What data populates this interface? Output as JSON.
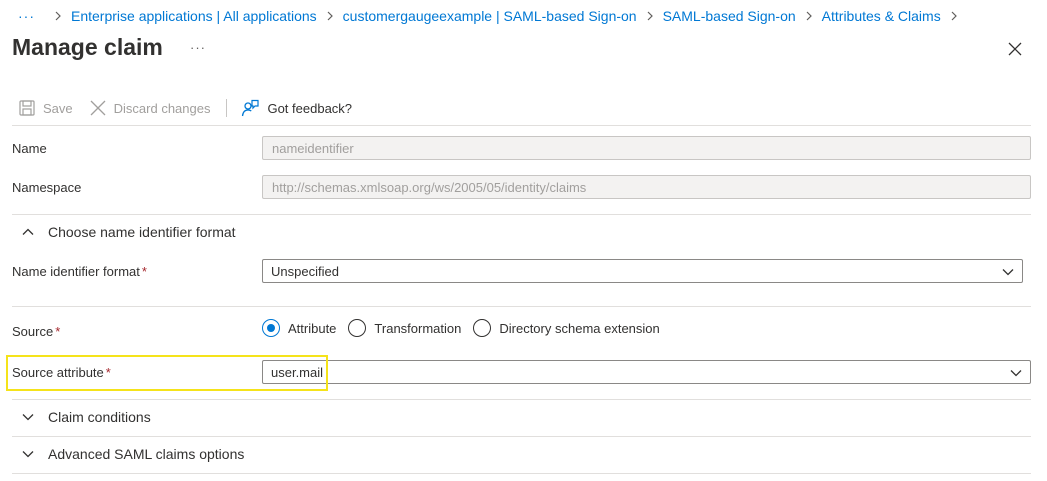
{
  "breadcrumb": {
    "more": "···",
    "items": [
      "Enterprise applications | All applications",
      "customergaugeexample | SAML-based Sign-on",
      "SAML-based Sign-on",
      "Attributes & Claims"
    ]
  },
  "header": {
    "title": "Manage claim",
    "more": "···"
  },
  "toolbar": {
    "save_label": "Save",
    "discard_label": "Discard changes",
    "feedback_label": "Got feedback?"
  },
  "form": {
    "name": {
      "label": "Name",
      "value": "nameidentifier"
    },
    "namespace": {
      "label": "Namespace",
      "value": "http://schemas.xmlsoap.org/ws/2005/05/identity/claims"
    },
    "name_id_section": {
      "label": "Choose name identifier format",
      "expanded": true
    },
    "name_id_format": {
      "label": "Name identifier format",
      "required": "*",
      "value": "Unspecified"
    },
    "source": {
      "label": "Source",
      "required": "*",
      "options": [
        "Attribute",
        "Transformation",
        "Directory schema extension"
      ],
      "selected": "Attribute"
    },
    "source_attribute": {
      "label": "Source attribute",
      "required": "*",
      "value": "user.mail"
    },
    "claim_conditions": {
      "label": "Claim conditions",
      "expanded": false
    },
    "advanced_saml": {
      "label": "Advanced SAML claims options",
      "expanded": false
    }
  },
  "colors": {
    "link": "#0078d4",
    "required": "#a4262c",
    "highlight": "#f5e31a",
    "disabled_bg": "#f3f2f1"
  },
  "icons": {
    "save": "save-icon",
    "discard": "close-icon",
    "feedback": "feedback-icon",
    "close": "close-icon",
    "chevron": "chevron-down-icon"
  }
}
